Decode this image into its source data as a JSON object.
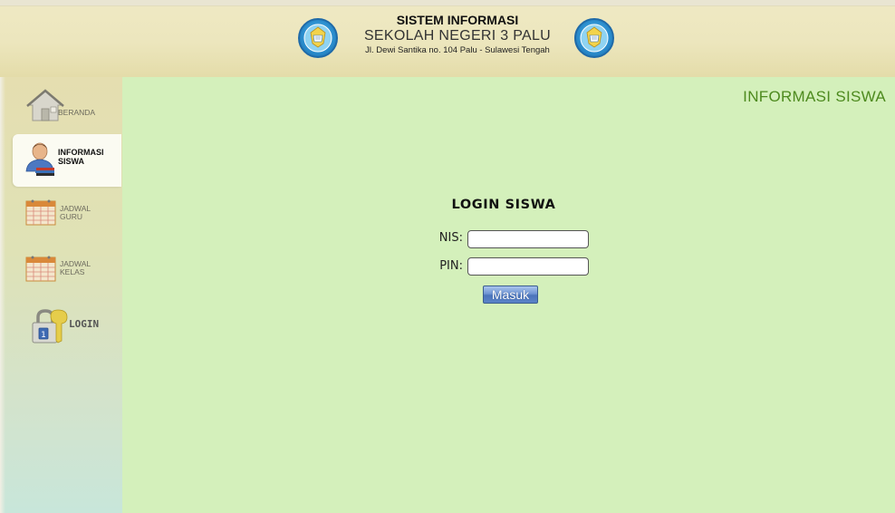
{
  "header": {
    "line1": "SISTEM INFORMASI",
    "line2": "SEKOLAH NEGERI 3 PALU",
    "line3": "Jl. Dewi Santika no. 104 Palu - Sulawesi Tengah",
    "emblem_icon": "school-emblem-icon"
  },
  "sidebar": {
    "items": [
      {
        "id": "beranda",
        "label": "BERANDA",
        "icon": "house-icon",
        "active": false
      },
      {
        "id": "informasi-siswa",
        "label_line1": "INFORMASI",
        "label_line2": "SISWA",
        "icon": "student-icon",
        "active": true
      },
      {
        "id": "jadwal-guru",
        "label_line1": "JADWAL",
        "label_line2": "GURU",
        "icon": "calendar-icon",
        "active": false
      },
      {
        "id": "jadwal-kelas",
        "label_line1": "JADWAL",
        "label_line2": "KELAS",
        "icon": "calendar-icon",
        "active": false
      },
      {
        "id": "login",
        "label": "LOGIN",
        "icon": "padlock-key-icon",
        "active": false
      }
    ]
  },
  "main": {
    "heading": "INFORMASI SISWA",
    "form": {
      "title": "LOGIN SISWA",
      "nis_label": "NIS:",
      "nis_value": "",
      "pin_label": "PIN:",
      "pin_value": "",
      "submit_label": "Masuk"
    }
  },
  "colors": {
    "header_bg": "#ece6bd",
    "main_bg": "#d4f0bb",
    "heading_green": "#4d8a1e",
    "button_blue": "#5b84c8",
    "active_tab": "#fbfbf2"
  }
}
